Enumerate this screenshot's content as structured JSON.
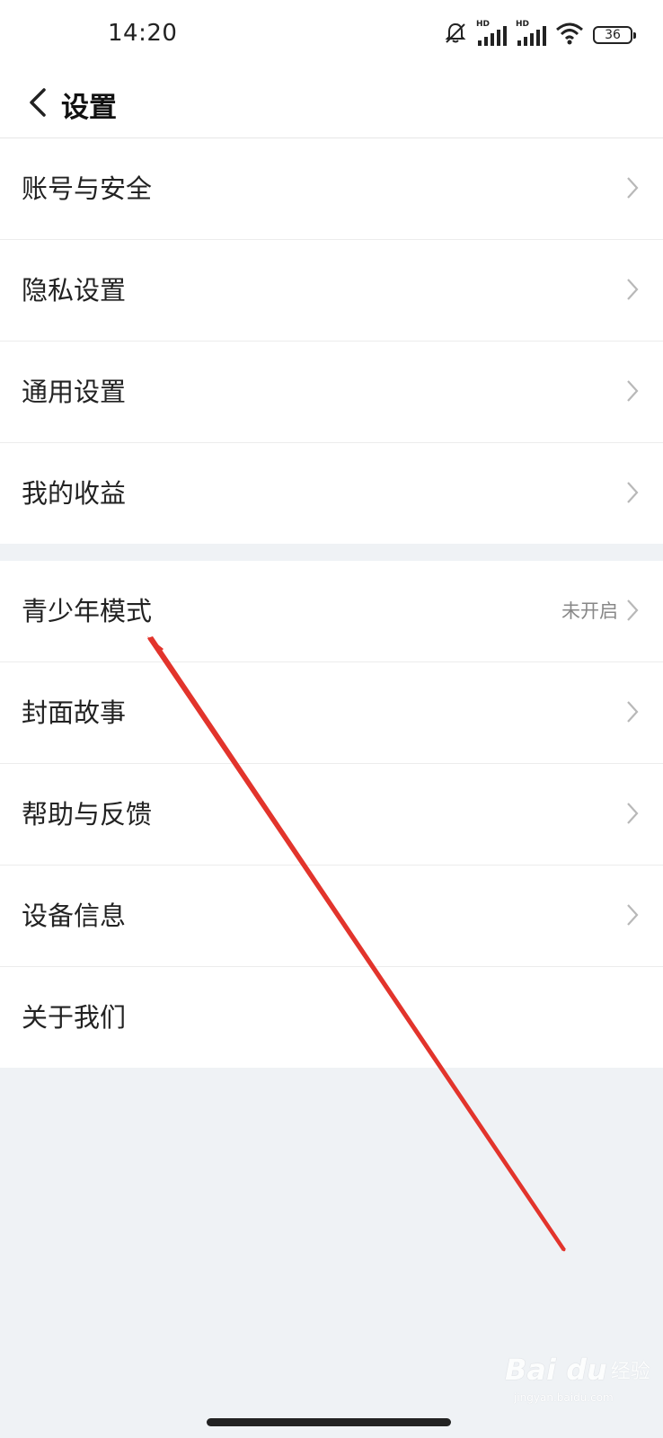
{
  "status_bar": {
    "time": "14:20",
    "sig_label_1": "HD",
    "sig_label_2": "HD",
    "battery": "36",
    "icons": [
      "bell-off-icon",
      "signal-icon",
      "signal-icon",
      "wifi-icon",
      "battery-icon"
    ]
  },
  "header": {
    "title": "设置",
    "back_icon": "chevron-left-icon"
  },
  "group1": [
    {
      "label": "账号与安全"
    },
    {
      "label": "隐私设置"
    },
    {
      "label": "通用设置"
    },
    {
      "label": "我的收益"
    }
  ],
  "group2": [
    {
      "label": "青少年模式",
      "value": "未开启"
    },
    {
      "label": "封面故事"
    },
    {
      "label": "帮助与反馈"
    },
    {
      "label": "设备信息"
    },
    {
      "label": "关于我们"
    }
  ],
  "watermark": {
    "logo": "Bai du",
    "text": "经验",
    "url": "jingyan.baidu.com"
  },
  "colors": {
    "annotation_arrow": "#e2342c",
    "background": "#eff2f5"
  }
}
